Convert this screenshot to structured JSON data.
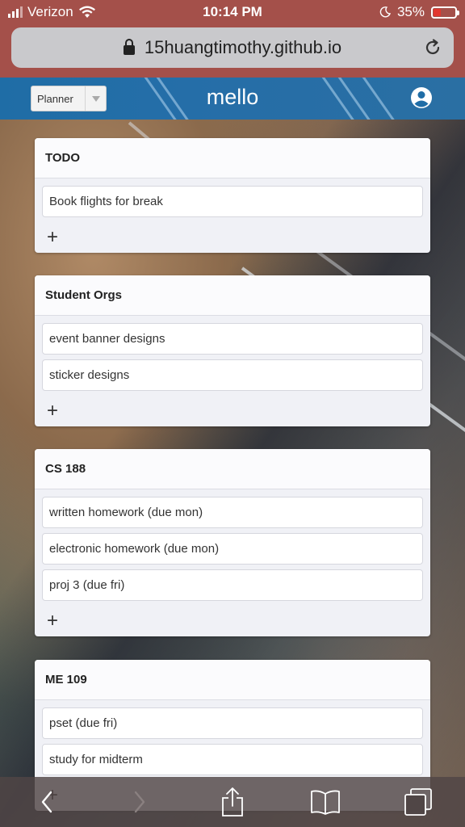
{
  "status_bar": {
    "carrier": "Verizon",
    "time": "10:14 PM",
    "battery_percent": "35%",
    "battery_level": 0.35
  },
  "browser": {
    "url": "15huangtimothy.github.io"
  },
  "header": {
    "board_select_value": "Planner",
    "app_title": "mello"
  },
  "lists": [
    {
      "title": "TODO",
      "cards": [
        "Book flights for break"
      ],
      "add_label": "+"
    },
    {
      "title": "Student Orgs",
      "cards": [
        "event banner designs",
        "sticker designs"
      ],
      "add_label": "+"
    },
    {
      "title": "CS 188",
      "cards": [
        "written homework (due mon)",
        "electronic homework (due mon)",
        "proj 3 (due fri)"
      ],
      "add_label": "+"
    },
    {
      "title": "ME 109",
      "cards": [
        "pset (due fri)",
        "study for midterm"
      ],
      "add_label": "+"
    }
  ],
  "colors": {
    "status_bar": "#a4504a",
    "header": "#1f6da6",
    "battery_fill": "#e2372f"
  },
  "icons": {
    "wifi": "wifi-icon",
    "moon": "moon-icon",
    "lock": "lock-icon",
    "reload": "reload-icon",
    "profile": "user-circle-icon",
    "back": "chevron-left-icon",
    "forward": "chevron-right-icon",
    "share": "share-icon",
    "bookmarks": "book-icon",
    "tabs": "tabs-icon"
  }
}
